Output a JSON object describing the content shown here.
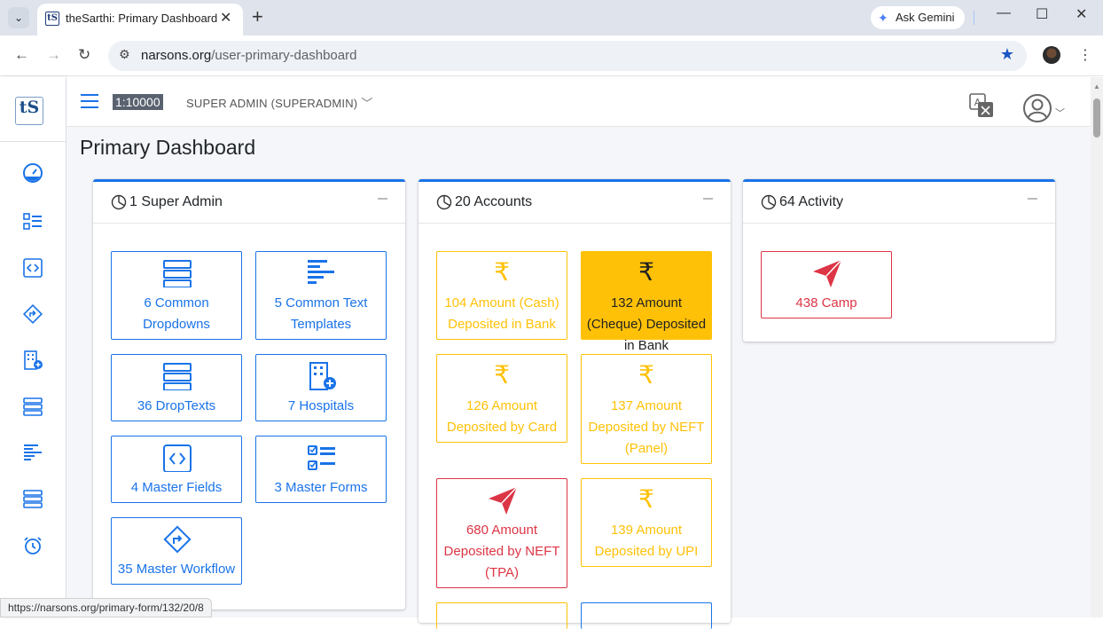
{
  "browser": {
    "tab_title": "theSarthi: Primary Dashboard",
    "favicon_text": "tS",
    "gemini_label": "Ask Gemini",
    "url_host": "narsons.org",
    "url_path": "/user-primary-dashboard",
    "status_url": "https://narsons.org/primary-form/132/20/8"
  },
  "header": {
    "scale_badge": "1:10000",
    "role_label": "SUPER ADMIN (SUPERADMIN)"
  },
  "page": {
    "title": "Primary Dashboard"
  },
  "sidebar": {
    "logo_text": "tS",
    "icons": [
      "dashboard-gauge-icon",
      "checklist-icon",
      "code-box-icon",
      "workflow-diamond-icon",
      "hospital-icon",
      "dropdown-list-icon",
      "text-templates-icon",
      "droptexts-icon",
      "alarm-clock-icon"
    ]
  },
  "cards": [
    {
      "title": "1 Super Admin",
      "tiles": [
        {
          "label": "6 Common Dropdowns",
          "icon": "dropdown-list-icon",
          "style": "blue"
        },
        {
          "label": "5 Common Text Templates",
          "icon": "text-templates-icon",
          "style": "blue"
        },
        {
          "label": "36 DropTexts",
          "icon": "droptexts-icon",
          "style": "blue"
        },
        {
          "label": "7 Hospitals",
          "icon": "hospital-icon",
          "style": "blue"
        },
        {
          "label": "4 Master Fields",
          "icon": "code-box-icon",
          "style": "blue"
        },
        {
          "label": "3 Master Forms",
          "icon": "checklist-icon",
          "style": "blue"
        },
        {
          "label": "35 Master Workflow",
          "icon": "workflow-diamond-icon",
          "style": "blue"
        }
      ]
    },
    {
      "title": "20 Accounts",
      "tiles": [
        {
          "label": "104 Amount (Cash) Deposited in Bank",
          "icon": "rupee-icon",
          "style": "yellow"
        },
        {
          "label": "132 Amount (Cheque) Deposited in Bank",
          "icon": "rupee-icon",
          "style": "yellow-filled"
        },
        {
          "label": "126 Amount Deposited by Card",
          "icon": "rupee-icon",
          "style": "yellow"
        },
        {
          "label": "137 Amount Deposited by NEFT (Panel)",
          "icon": "rupee-icon",
          "style": "yellow"
        },
        {
          "label": "680 Amount Deposited by NEFT (TPA)",
          "icon": "paper-plane-icon",
          "style": "red"
        },
        {
          "label": "139 Amount Deposited by UPI",
          "icon": "rupee-icon",
          "style": "yellow"
        }
      ]
    },
    {
      "title": "64 Activity",
      "tiles": [
        {
          "label": "438 Camp",
          "icon": "paper-plane-icon",
          "style": "red"
        }
      ]
    }
  ],
  "colors": {
    "primary": "#1a73e8",
    "warning": "#ffc107",
    "danger": "#dc3545"
  }
}
